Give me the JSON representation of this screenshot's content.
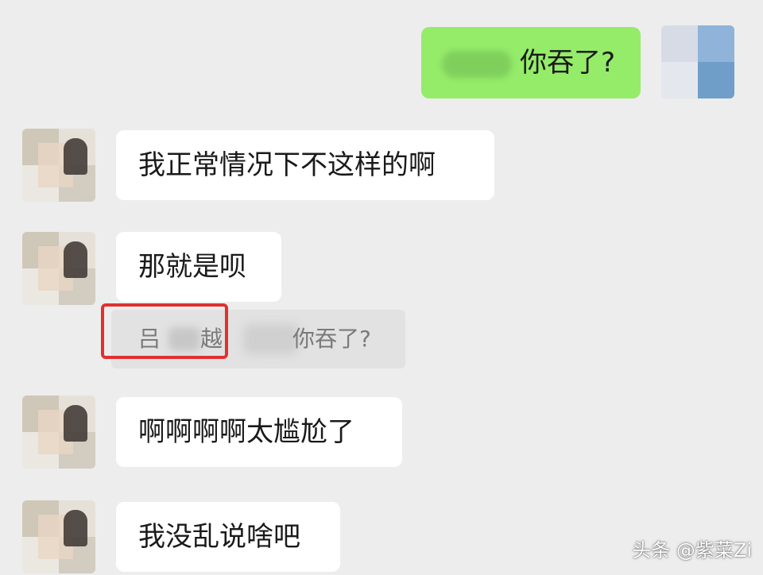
{
  "chat": {
    "outgoing": {
      "text": "你吞了?"
    },
    "incoming": [
      {
        "text": "我正常情况下不这样的啊"
      },
      {
        "text": "那就是呗"
      },
      {
        "text": "啊啊啊啊太尴尬了"
      },
      {
        "text": "我没乱说啥吧"
      }
    ],
    "quote": {
      "name_start": "吕",
      "name_end": "​越:",
      "message": "你吞了?"
    }
  },
  "watermark": "头条 @紫菜Zi",
  "colors": {
    "background": "#ededed",
    "outgoing_bubble": "#95ec69",
    "incoming_bubble": "#ffffff",
    "highlight_border": "#e0312f"
  }
}
